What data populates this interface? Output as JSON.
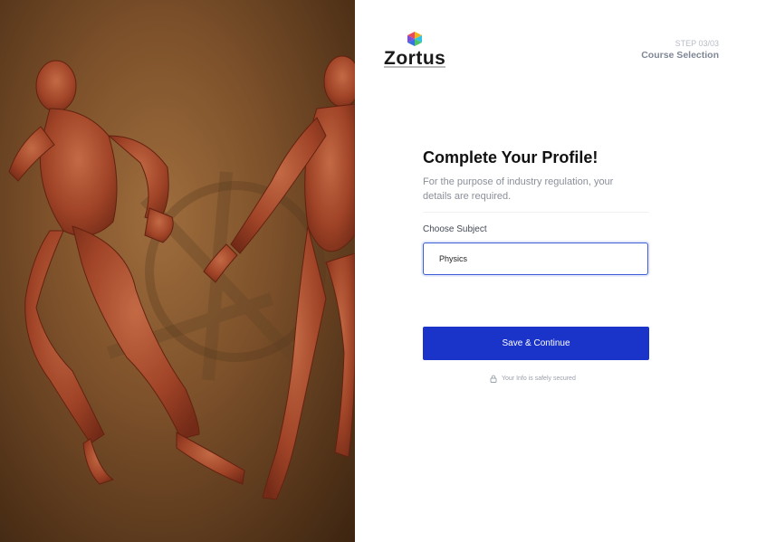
{
  "brand": {
    "name": "Zortus"
  },
  "step": {
    "label": "STEP 03/03",
    "name": "Course Selection"
  },
  "form": {
    "title": "Complete Your Profile!",
    "subtitle": "For the purpose of industry regulation, your details are required.",
    "subject_label": "Choose Subject",
    "subject_value": "Physics",
    "submit_label": "Save & Continue",
    "secure_note": "Your Info is safely secured"
  },
  "colors": {
    "primary": "#1a33c9",
    "input_border": "#3a5bd6",
    "muted_text": "#8a8f99"
  },
  "icons": [
    "zortus-logo-icon",
    "lock-icon"
  ]
}
